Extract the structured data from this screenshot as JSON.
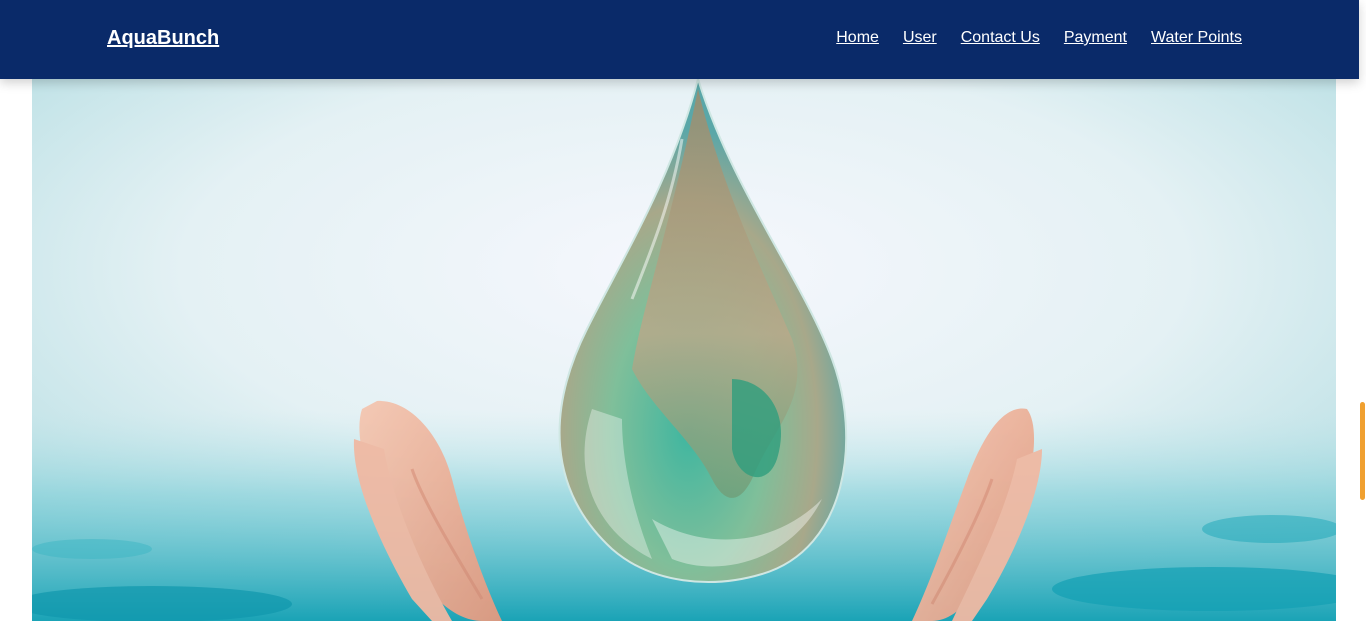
{
  "header": {
    "brand": "AquaBunch",
    "nav": [
      {
        "label": "Home"
      },
      {
        "label": "User"
      },
      {
        "label": "Contact Us"
      },
      {
        "label": "Payment"
      },
      {
        "label": "Water Points"
      }
    ]
  },
  "colors": {
    "navbar_bg": "#0a2a69",
    "nav_text": "#ffffff",
    "scroll_accent": "#f0a030"
  },
  "hero": {
    "image_icon": "earth-water-drop-in-hands-image"
  }
}
